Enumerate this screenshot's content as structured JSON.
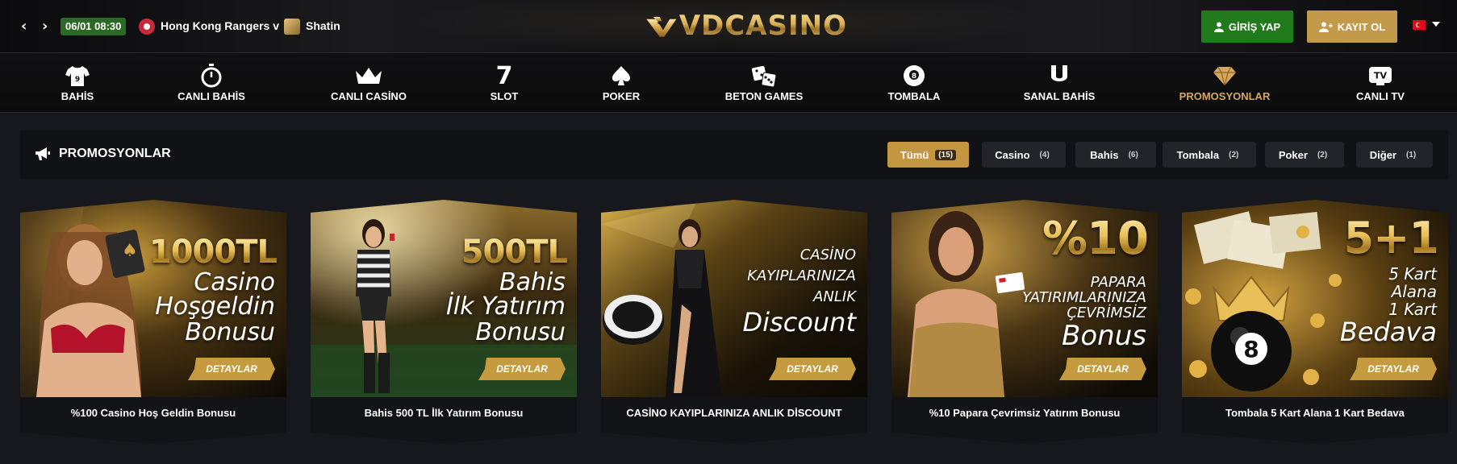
{
  "topbar": {
    "match_time": "06/01 08:30",
    "home_team": "Hong Kong Rangers v",
    "away_team": "Shatin",
    "logo_text": "VDCASINO",
    "login_label": "GİRİŞ YAP",
    "register_label": "KAYIT OL"
  },
  "nav": {
    "items": [
      {
        "label": "BAHİS",
        "icon": "jersey-icon"
      },
      {
        "label": "CANLI BAHİS",
        "icon": "stopwatch-icon"
      },
      {
        "label": "CANLI CASİNO",
        "icon": "crown-icon"
      },
      {
        "label": "SLOT",
        "icon": "seven-icon"
      },
      {
        "label": "POKER",
        "icon": "spade-icon"
      },
      {
        "label": "BETON GAMES",
        "icon": "dice-icon"
      },
      {
        "label": "TOMBALA",
        "icon": "eight-ball-icon"
      },
      {
        "label": "SANAL BAHİS",
        "icon": "horseshoe-icon"
      },
      {
        "label": "PROMOSYONLAR",
        "icon": "diamond-icon"
      },
      {
        "label": "CANLI TV",
        "icon": "tv-icon"
      }
    ],
    "tv_glyph": "TV",
    "seven_glyph": "7"
  },
  "promo": {
    "title": "PROMOSYONLAR",
    "filters": [
      {
        "label": "Tümü",
        "count": "(15)"
      },
      {
        "label": "Casino",
        "count": "(4)"
      },
      {
        "label": "Bahis",
        "count": "(6)"
      },
      {
        "label": "Tombala",
        "count": "(2)"
      },
      {
        "label": "Poker",
        "count": "(2)"
      },
      {
        "label": "Diğer",
        "count": "(1)"
      }
    ]
  },
  "cards": [
    {
      "gold": "1000TL",
      "lines": [
        "Casino",
        "Hoşgeldin",
        "Bonusu"
      ],
      "button": "DETAYLAR",
      "title": "%100 Casino Hoş Geldin Bonusu"
    },
    {
      "gold": "500TL",
      "lines": [
        "Bahis",
        "İlk Yatırım",
        "Bonusu"
      ],
      "button": "DETAYLAR",
      "title": "Bahis 500 TL İlk Yatırım Bonusu"
    },
    {
      "gold": "",
      "lines": [
        "CASİNO",
        "KAYIPLARINIZA",
        "ANLIK",
        "Discount"
      ],
      "button": "DETAYLAR",
      "title": "CASİNO KAYIPLARINIZA ANLIK DİSCOUNT"
    },
    {
      "gold": "%10",
      "lines": [
        "PAPARA",
        "YATIRIMLARINIZA",
        "ÇEVRİMSİZ",
        "Bonus"
      ],
      "button": "DETAYLAR",
      "title": "%10 Papara Çevrimsiz Yatırım Bonusu"
    },
    {
      "gold": "5+1",
      "lines": [
        "5 Kart",
        "Alana",
        "1 Kart",
        "Bedava"
      ],
      "button": "DETAYLAR",
      "title": "Tombala 5 Kart Alana 1 Kart Bedava"
    }
  ],
  "colors": {
    "accent_gold": "#c69a3f",
    "login_green": "#217a1c",
    "register_gold": "#c39a4a",
    "active_nav": "#d7a85a",
    "match_time_bg": "#2a6a24"
  }
}
